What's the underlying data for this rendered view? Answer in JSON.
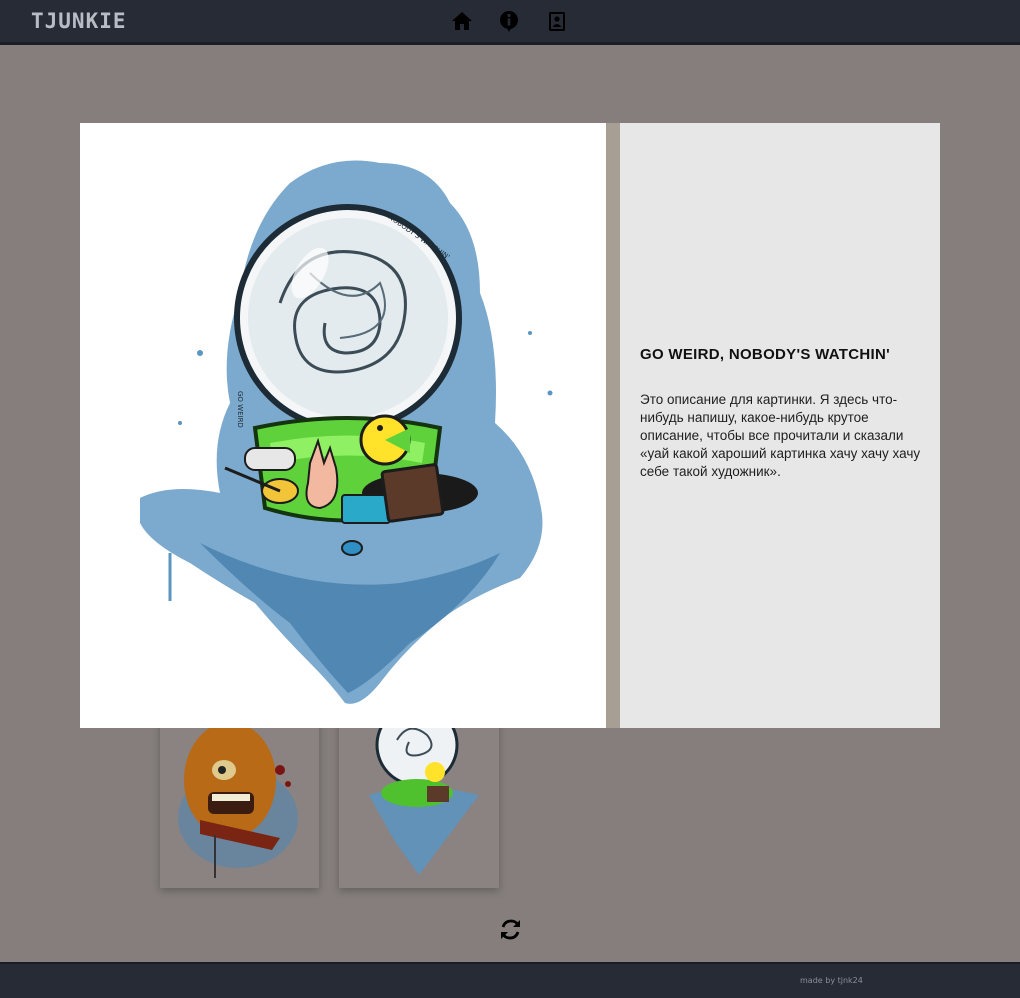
{
  "header": {
    "logo": "TJUNKIE",
    "nav": [
      {
        "name": "home-icon"
      },
      {
        "name": "info-icon"
      },
      {
        "name": "contacts-book-icon"
      }
    ]
  },
  "gallery": {
    "cards": [
      {
        "name": "gallery-card-pizza"
      },
      {
        "name": "gallery-card-snowglobe"
      }
    ],
    "reload_icon": "reload-icon"
  },
  "modal": {
    "title": "GO WEIRD, NOBODY'S WATCHIN'",
    "description": "Это описание для картинки. Я здесь что-нибудь напишу, какое-нибудь крутое описание, чтобы все прочитали и сказали «уай какой хароший картинка хачу хачу хачу себе такой художник».",
    "artwork_texts": [
      "NOBODY'S WATCHIN'",
      "GO WEIRD"
    ]
  },
  "footer": {
    "credit": "made by tjnk24"
  },
  "colors": {
    "topbar": "#262b35",
    "page_bg": "#857e7c",
    "modal_info_bg": "#e7e7e7",
    "accent_blue": "#5b95c2",
    "accent_green": "#5fd13a"
  }
}
